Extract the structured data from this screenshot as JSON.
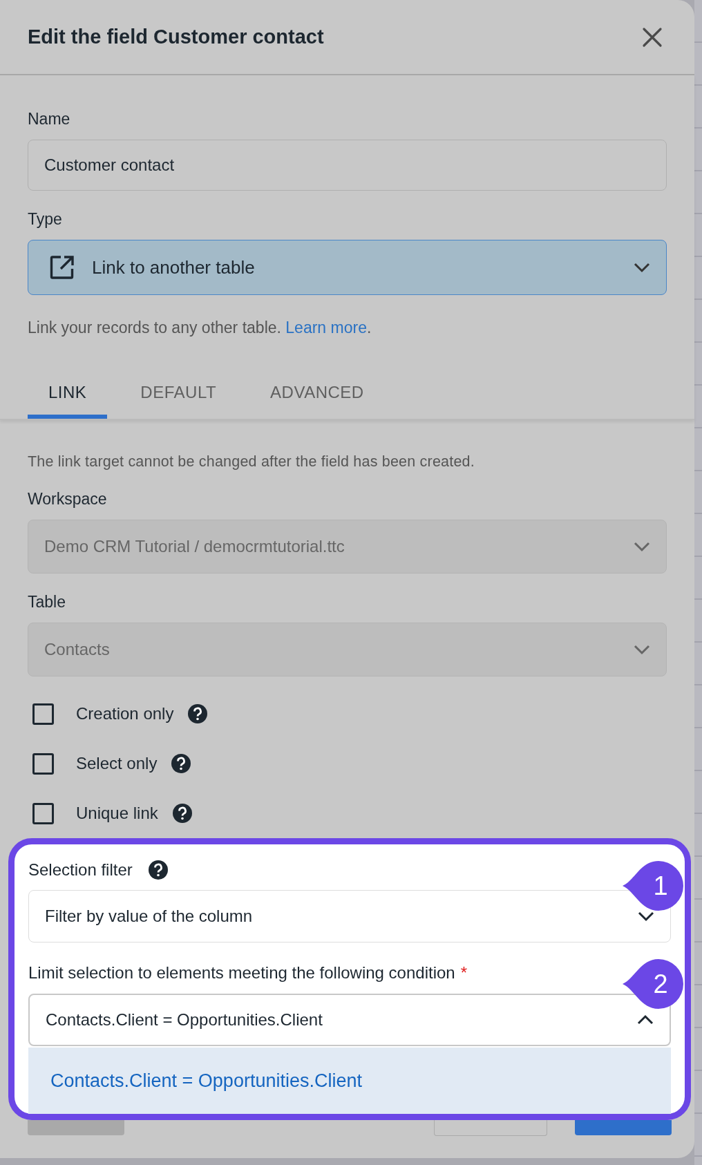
{
  "dialog": {
    "title": "Edit the field Customer contact"
  },
  "name_field": {
    "label": "Name",
    "value": "Customer contact"
  },
  "type_field": {
    "label": "Type",
    "value": "Link to another table",
    "focused": true
  },
  "help": {
    "text": "Link your records to any other table.",
    "link": "Learn more",
    "after": "."
  },
  "tabs": [
    {
      "label": "LINK",
      "selected": true
    },
    {
      "label": "DEFAULT",
      "selected": false
    },
    {
      "label": "ADVANCED",
      "selected": false
    }
  ],
  "note": "The link target cannot be changed after the field has been created.",
  "workspace": {
    "label": "Workspace",
    "value": "Demo CRM Tutorial / democrmtutorial.ttc",
    "disabled": true
  },
  "table": {
    "label": "Table",
    "value": "Contacts",
    "disabled": true
  },
  "checkboxes": [
    {
      "label": "Creation only",
      "checked": false
    },
    {
      "label": "Select only",
      "checked": false
    },
    {
      "label": "Unique link",
      "checked": false
    }
  ],
  "selection_filter": {
    "label": "Selection filter",
    "value": "Filter by value of the column",
    "expanded": false
  },
  "condition": {
    "label": "Limit selection to elements meeting the following condition",
    "required": true,
    "required_mark": "*",
    "value": "Contacts.Client = Opportunities.Client",
    "expanded": true,
    "options": [
      {
        "label": "Contacts.Client = Opportunities.Client",
        "selected": true
      }
    ]
  },
  "callouts": [
    "1",
    "2"
  ],
  "footer_buttons": [
    {
      "kind": "secondary"
    },
    {
      "kind": "outline"
    },
    {
      "kind": "primary"
    }
  ]
}
